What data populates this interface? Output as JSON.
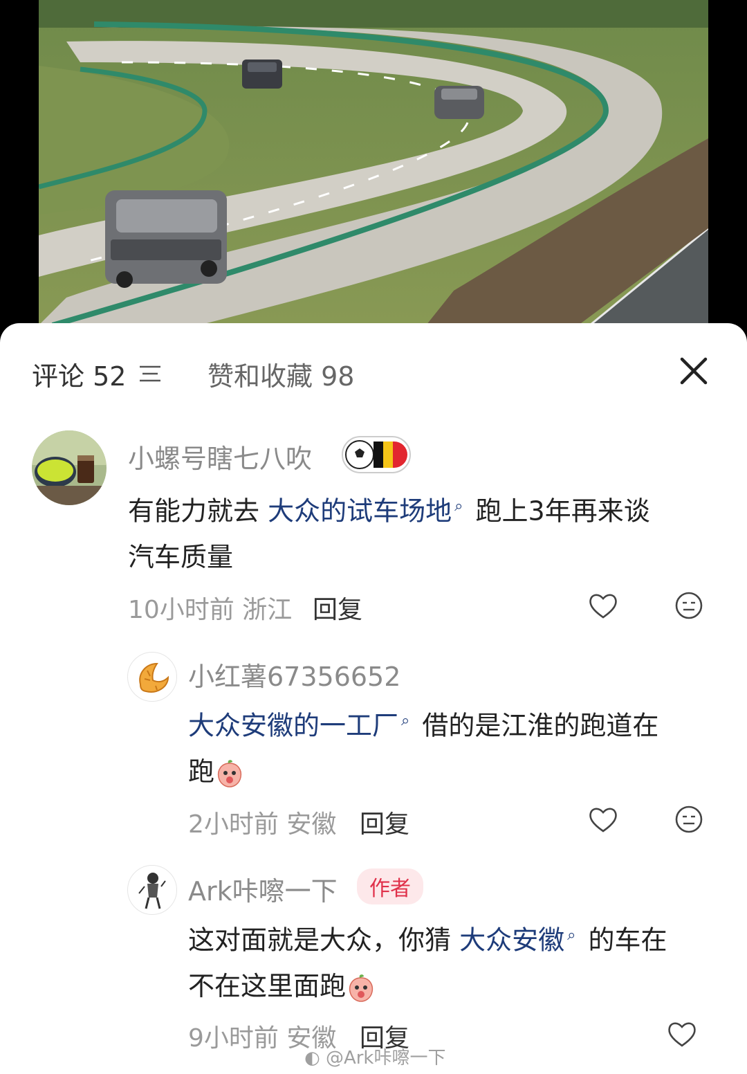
{
  "header": {
    "comments_label": "评论 52",
    "likes_label": "赞和收藏 98"
  },
  "comments": [
    {
      "username": "小螺号瞎七八吹",
      "badge_icon": "soccer-belgium-flag-badge",
      "text_before": "有能力就去 ",
      "link": "大众的试车场地",
      "text_after": " 跑上3年再来谈",
      "text_line2": "汽车质量",
      "time": "10小时前",
      "location": "浙江",
      "reply_label": "回复"
    },
    {
      "username": "小红薯67356652",
      "link": "大众安徽的一工厂",
      "text_after": " 借的是江淮的跑道在",
      "text_line2": "跑",
      "time": "2小时前",
      "location": "安徽",
      "reply_label": "回复"
    },
    {
      "username": "Ark咔嚓一下",
      "author_badge": "作者",
      "text_before": "这对面就是大众，你猜 ",
      "link": "大众安徽",
      "text_after": " 的车在",
      "text_line2": "不在这里面跑",
      "time": "9小时前",
      "location": "安徽",
      "reply_label": "回复"
    }
  ],
  "watermark": "@Ark咔嚓一下",
  "colors": {
    "link": "#1e3c7a",
    "author_badge_text": "#e0304a",
    "author_badge_bg": "#fde8ea",
    "meta_text": "#9a9a9a"
  }
}
